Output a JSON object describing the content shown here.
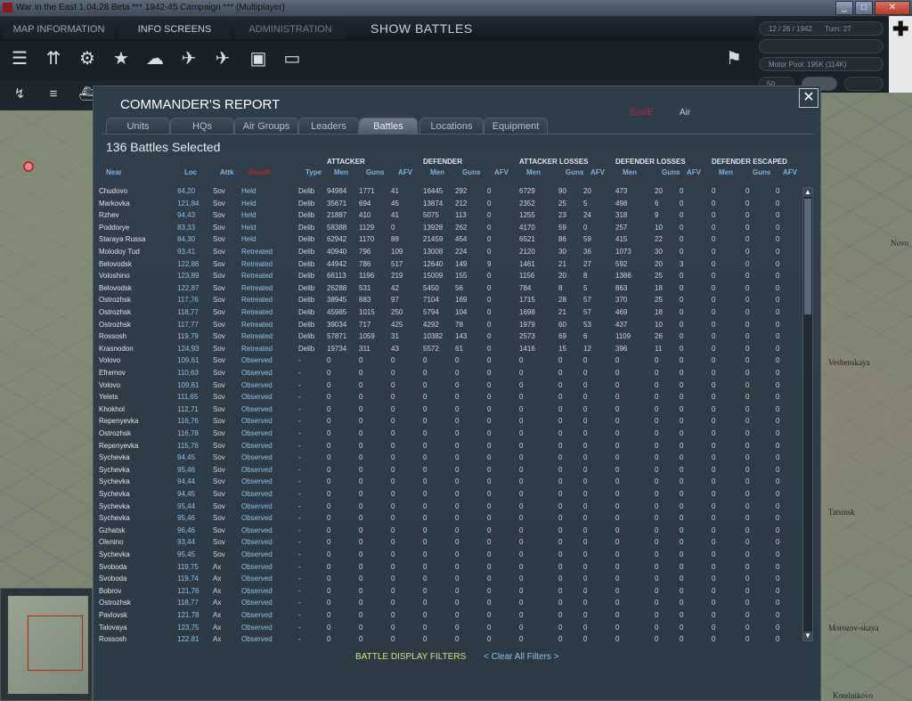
{
  "window": {
    "title": "War in the East 1.04.28 Beta      ***   1942-45 Campaign   ***   (Multiplayer)"
  },
  "topbar": {
    "tabs": [
      "MAP INFORMATION",
      "INFO SCREENS",
      "ADMINISTRATION"
    ],
    "show_battles": "SHOW BATTLES"
  },
  "status": {
    "date": "12 / 26 / 1942",
    "turn": "Turn: 27",
    "motor_pool": "Motor Pool:  195K (114K)",
    "field_value": "50"
  },
  "map_labels": [
    "Novo",
    "Vesbenskaya",
    "Morozov-skaya",
    "Tatsinsk",
    "Kotelnikovo"
  ],
  "report": {
    "title": "COMMANDER'S REPORT",
    "filter_sov": "Sov/E",
    "filter_air": "Air",
    "tabs": [
      "Units",
      "HQs",
      "Air Groups",
      "Leaders",
      "Battles",
      "Locations",
      "Equipment"
    ],
    "active_tab": "Battles",
    "count_label": "136 Battles Selected",
    "groups": [
      "ATTACKER",
      "DEFENDER",
      "ATTACKER LOSSES",
      "DEFENDER LOSSES",
      "DEFENDER ESCAPED"
    ],
    "columns": [
      "Near",
      "Loc",
      "Attk",
      "Result",
      "Type",
      "Men",
      "Guns",
      "AFV",
      "Men",
      "Guns",
      "AFV",
      "Men",
      "Guns",
      "AFV",
      "Men",
      "Guns",
      "AFV",
      "Men",
      "Guns",
      "AFV"
    ],
    "rows": [
      [
        "Chudovo",
        "84,20",
        "Sov",
        "Held",
        "Delib",
        "94984",
        "1771",
        "41",
        "16445",
        "292",
        "0",
        "6729",
        "90",
        "20",
        "473",
        "20",
        "0",
        "0",
        "0",
        "0"
      ],
      [
        "Markovka",
        "121,84",
        "Sov",
        "Held",
        "Delib",
        "35671",
        "694",
        "45",
        "13874",
        "212",
        "0",
        "2352",
        "25",
        "5",
        "498",
        "6",
        "0",
        "0",
        "0",
        "0"
      ],
      [
        "Rzhev",
        "94,43",
        "Sov",
        "Held",
        "Delib",
        "21887",
        "410",
        "41",
        "5075",
        "113",
        "0",
        "1255",
        "23",
        "24",
        "318",
        "9",
        "0",
        "0",
        "0",
        "0"
      ],
      [
        "Poddorye",
        "83,33",
        "Sov",
        "Held",
        "Delib",
        "58388",
        "1129",
        "0",
        "13928",
        "262",
        "0",
        "4170",
        "59",
        "0",
        "257",
        "10",
        "0",
        "0",
        "0",
        "0"
      ],
      [
        "Staraya Russa",
        "84,30",
        "Sov",
        "Held",
        "Delib",
        "62942",
        "1170",
        "88",
        "21459",
        "454",
        "0",
        "6521",
        "86",
        "59",
        "415",
        "22",
        "0",
        "0",
        "0",
        "0"
      ],
      [
        "Molodoy Tud",
        "93,41",
        "Sov",
        "Retreated",
        "Delib",
        "40940",
        "796",
        "109",
        "13008",
        "224",
        "0",
        "2120",
        "30",
        "36",
        "1073",
        "30",
        "0",
        "0",
        "0",
        "0"
      ],
      [
        "Belovodsk",
        "122,86",
        "Sov",
        "Retreated",
        "Delib",
        "44942",
        "786",
        "517",
        "12640",
        "149",
        "9",
        "1461",
        "21",
        "27",
        "592",
        "20",
        "3",
        "0",
        "0",
        "0"
      ],
      [
        "Voloshino",
        "123,89",
        "Sov",
        "Retreated",
        "Delib",
        "66113",
        "1196",
        "219",
        "15009",
        "155",
        "0",
        "1156",
        "20",
        "8",
        "1386",
        "25",
        "0",
        "0",
        "0",
        "0"
      ],
      [
        "Belovodsk",
        "122,87",
        "Sov",
        "Retreated",
        "Delib",
        "26288",
        "531",
        "42",
        "5450",
        "56",
        "0",
        "784",
        "8",
        "5",
        "863",
        "18",
        "0",
        "0",
        "0",
        "0"
      ],
      [
        "Ostrozhsk",
        "117,76",
        "Sov",
        "Retreated",
        "Delib",
        "38945",
        "883",
        "97",
        "7104",
        "169",
        "0",
        "1715",
        "28",
        "57",
        "370",
        "25",
        "0",
        "0",
        "0",
        "0"
      ],
      [
        "Ostrozhsk",
        "118,77",
        "Sov",
        "Retreated",
        "Delib",
        "45985",
        "1015",
        "250",
        "5794",
        "104",
        "0",
        "1698",
        "21",
        "57",
        "469",
        "18",
        "0",
        "0",
        "0",
        "0"
      ],
      [
        "Ostrozhsk",
        "117,77",
        "Sov",
        "Retreated",
        "Delib",
        "39034",
        "717",
        "425",
        "4292",
        "78",
        "0",
        "1979",
        "60",
        "53",
        "437",
        "10",
        "0",
        "0",
        "0",
        "0"
      ],
      [
        "Rossosh",
        "119,79",
        "Sov",
        "Retreated",
        "Delib",
        "57871",
        "1059",
        "31",
        "10382",
        "143",
        "0",
        "2573",
        "69",
        "6",
        "1109",
        "26",
        "0",
        "0",
        "0",
        "0"
      ],
      [
        "Krasnodon",
        "124,93",
        "Sov",
        "Retreated",
        "Delib",
        "19734",
        "311",
        "43",
        "5572",
        "61",
        "0",
        "1416",
        "15",
        "12",
        "396",
        "11",
        "0",
        "0",
        "0",
        "0"
      ],
      [
        "Volovo",
        "109,61",
        "Sov",
        "Observed",
        "-",
        "0",
        "0",
        "0",
        "0",
        "0",
        "0",
        "0",
        "0",
        "0",
        "0",
        "0",
        "0",
        "0",
        "0",
        "0"
      ],
      [
        "Efremov",
        "110,63",
        "Sov",
        "Observed",
        "-",
        "0",
        "0",
        "0",
        "0",
        "0",
        "0",
        "0",
        "0",
        "0",
        "0",
        "0",
        "0",
        "0",
        "0",
        "0"
      ],
      [
        "Volovo",
        "109,61",
        "Sov",
        "Observed",
        "-",
        "0",
        "0",
        "0",
        "0",
        "0",
        "0",
        "0",
        "0",
        "0",
        "0",
        "0",
        "0",
        "0",
        "0",
        "0"
      ],
      [
        "Yelets",
        "111,65",
        "Sov",
        "Observed",
        "-",
        "0",
        "0",
        "0",
        "0",
        "0",
        "0",
        "0",
        "0",
        "0",
        "0",
        "0",
        "0",
        "0",
        "0",
        "0"
      ],
      [
        "Khokhol",
        "112,71",
        "Sov",
        "Observed",
        "-",
        "0",
        "0",
        "0",
        "0",
        "0",
        "0",
        "0",
        "0",
        "0",
        "0",
        "0",
        "0",
        "0",
        "0",
        "0"
      ],
      [
        "Repenyevka",
        "116,76",
        "Sov",
        "Observed",
        "-",
        "0",
        "0",
        "0",
        "0",
        "0",
        "0",
        "0",
        "0",
        "0",
        "0",
        "0",
        "0",
        "0",
        "0",
        "0"
      ],
      [
        "Ostrozhsk",
        "116,78",
        "Sov",
        "Observed",
        "-",
        "0",
        "0",
        "0",
        "0",
        "0",
        "0",
        "0",
        "0",
        "0",
        "0",
        "0",
        "0",
        "0",
        "0",
        "0"
      ],
      [
        "Repenyevka",
        "115,76",
        "Sov",
        "Observed",
        "-",
        "0",
        "0",
        "0",
        "0",
        "0",
        "0",
        "0",
        "0",
        "0",
        "0",
        "0",
        "0",
        "0",
        "0",
        "0"
      ],
      [
        "Sychevka",
        "94,45",
        "Sov",
        "Observed",
        "-",
        "0",
        "0",
        "0",
        "0",
        "0",
        "0",
        "0",
        "0",
        "0",
        "0",
        "0",
        "0",
        "0",
        "0",
        "0"
      ],
      [
        "Sychevka",
        "95,46",
        "Sov",
        "Observed",
        "-",
        "0",
        "0",
        "0",
        "0",
        "0",
        "0",
        "0",
        "0",
        "0",
        "0",
        "0",
        "0",
        "0",
        "0",
        "0"
      ],
      [
        "Sychevka",
        "94,44",
        "Sov",
        "Observed",
        "-",
        "0",
        "0",
        "0",
        "0",
        "0",
        "0",
        "0",
        "0",
        "0",
        "0",
        "0",
        "0",
        "0",
        "0",
        "0"
      ],
      [
        "Sychevka",
        "94,45",
        "Sov",
        "Observed",
        "-",
        "0",
        "0",
        "0",
        "0",
        "0",
        "0",
        "0",
        "0",
        "0",
        "0",
        "0",
        "0",
        "0",
        "0",
        "0"
      ],
      [
        "Sychevka",
        "95,44",
        "Sov",
        "Observed",
        "-",
        "0",
        "0",
        "0",
        "0",
        "0",
        "0",
        "0",
        "0",
        "0",
        "0",
        "0",
        "0",
        "0",
        "0",
        "0"
      ],
      [
        "Sychevka",
        "95,46",
        "Sov",
        "Observed",
        "-",
        "0",
        "0",
        "0",
        "0",
        "0",
        "0",
        "0",
        "0",
        "0",
        "0",
        "0",
        "0",
        "0",
        "0",
        "0"
      ],
      [
        "Gzhatsk",
        "96,46",
        "Sov",
        "Observed",
        "-",
        "0",
        "0",
        "0",
        "0",
        "0",
        "0",
        "0",
        "0",
        "0",
        "0",
        "0",
        "0",
        "0",
        "0",
        "0"
      ],
      [
        "Olenino",
        "93,44",
        "Sov",
        "Observed",
        "-",
        "0",
        "0",
        "0",
        "0",
        "0",
        "0",
        "0",
        "0",
        "0",
        "0",
        "0",
        "0",
        "0",
        "0",
        "0"
      ],
      [
        "Sychevka",
        "95,45",
        "Sov",
        "Observed",
        "-",
        "0",
        "0",
        "0",
        "0",
        "0",
        "0",
        "0",
        "0",
        "0",
        "0",
        "0",
        "0",
        "0",
        "0",
        "0"
      ],
      [
        "Svoboda",
        "119,75",
        "Ax",
        "Observed",
        "-",
        "0",
        "0",
        "0",
        "0",
        "0",
        "0",
        "0",
        "0",
        "0",
        "0",
        "0",
        "0",
        "0",
        "0",
        "0"
      ],
      [
        "Svoboda",
        "119,74",
        "Ax",
        "Observed",
        "-",
        "0",
        "0",
        "0",
        "0",
        "0",
        "0",
        "0",
        "0",
        "0",
        "0",
        "0",
        "0",
        "0",
        "0",
        "0"
      ],
      [
        "Bobrov",
        "121,76",
        "Ax",
        "Observed",
        "-",
        "0",
        "0",
        "0",
        "0",
        "0",
        "0",
        "0",
        "0",
        "0",
        "0",
        "0",
        "0",
        "0",
        "0",
        "0"
      ],
      [
        "Ostrozhsk",
        "118,77",
        "Ax",
        "Observed",
        "-",
        "0",
        "0",
        "0",
        "0",
        "0",
        "0",
        "0",
        "0",
        "0",
        "0",
        "0",
        "0",
        "0",
        "0",
        "0"
      ],
      [
        "Pavlovsk",
        "121,78",
        "Ax",
        "Observed",
        "-",
        "0",
        "0",
        "0",
        "0",
        "0",
        "0",
        "0",
        "0",
        "0",
        "0",
        "0",
        "0",
        "0",
        "0",
        "0"
      ],
      [
        "Talovaya",
        "123,75",
        "Ax",
        "Observed",
        "-",
        "0",
        "0",
        "0",
        "0",
        "0",
        "0",
        "0",
        "0",
        "0",
        "0",
        "0",
        "0",
        "0",
        "0",
        "0"
      ],
      [
        "Rossosh",
        "122,81",
        "Ax",
        "Observed",
        "-",
        "0",
        "0",
        "0",
        "0",
        "0",
        "0",
        "0",
        "0",
        "0",
        "0",
        "0",
        "0",
        "0",
        "0",
        "0"
      ]
    ],
    "filters_label": "BATTLE DISPLAY FILTERS",
    "clear_filters": "< Clear All Filters >"
  }
}
